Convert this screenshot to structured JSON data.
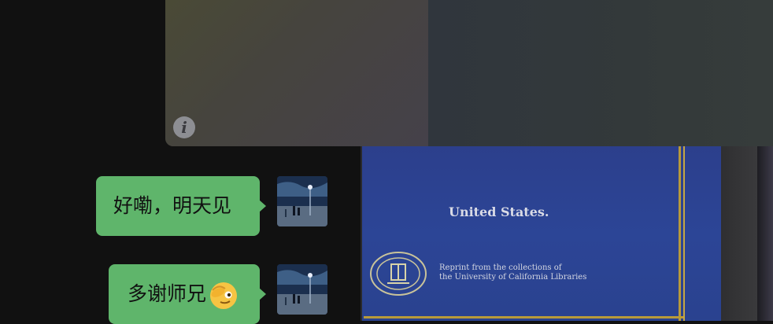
{
  "preview": {
    "info_icon": "info-icon",
    "info_glyph": "i"
  },
  "document": {
    "title": "United States.",
    "reprint_line1": "Reprint from the collections of",
    "reprint_line2": "the University of California Libraries",
    "seal_icon": "university-seal"
  },
  "messages": [
    {
      "text": "好嘞，明天见",
      "sender": "self",
      "avatar": "avatar-night-street"
    },
    {
      "text": "多谢师兄",
      "emoji": "saluting-face-emoji",
      "sender": "self",
      "avatar": "avatar-night-street"
    }
  ],
  "colors": {
    "bubble": "#5fb56b",
    "background": "#111111",
    "doc_blue": "#2c4596",
    "frame_gold": "#b89a3a"
  }
}
